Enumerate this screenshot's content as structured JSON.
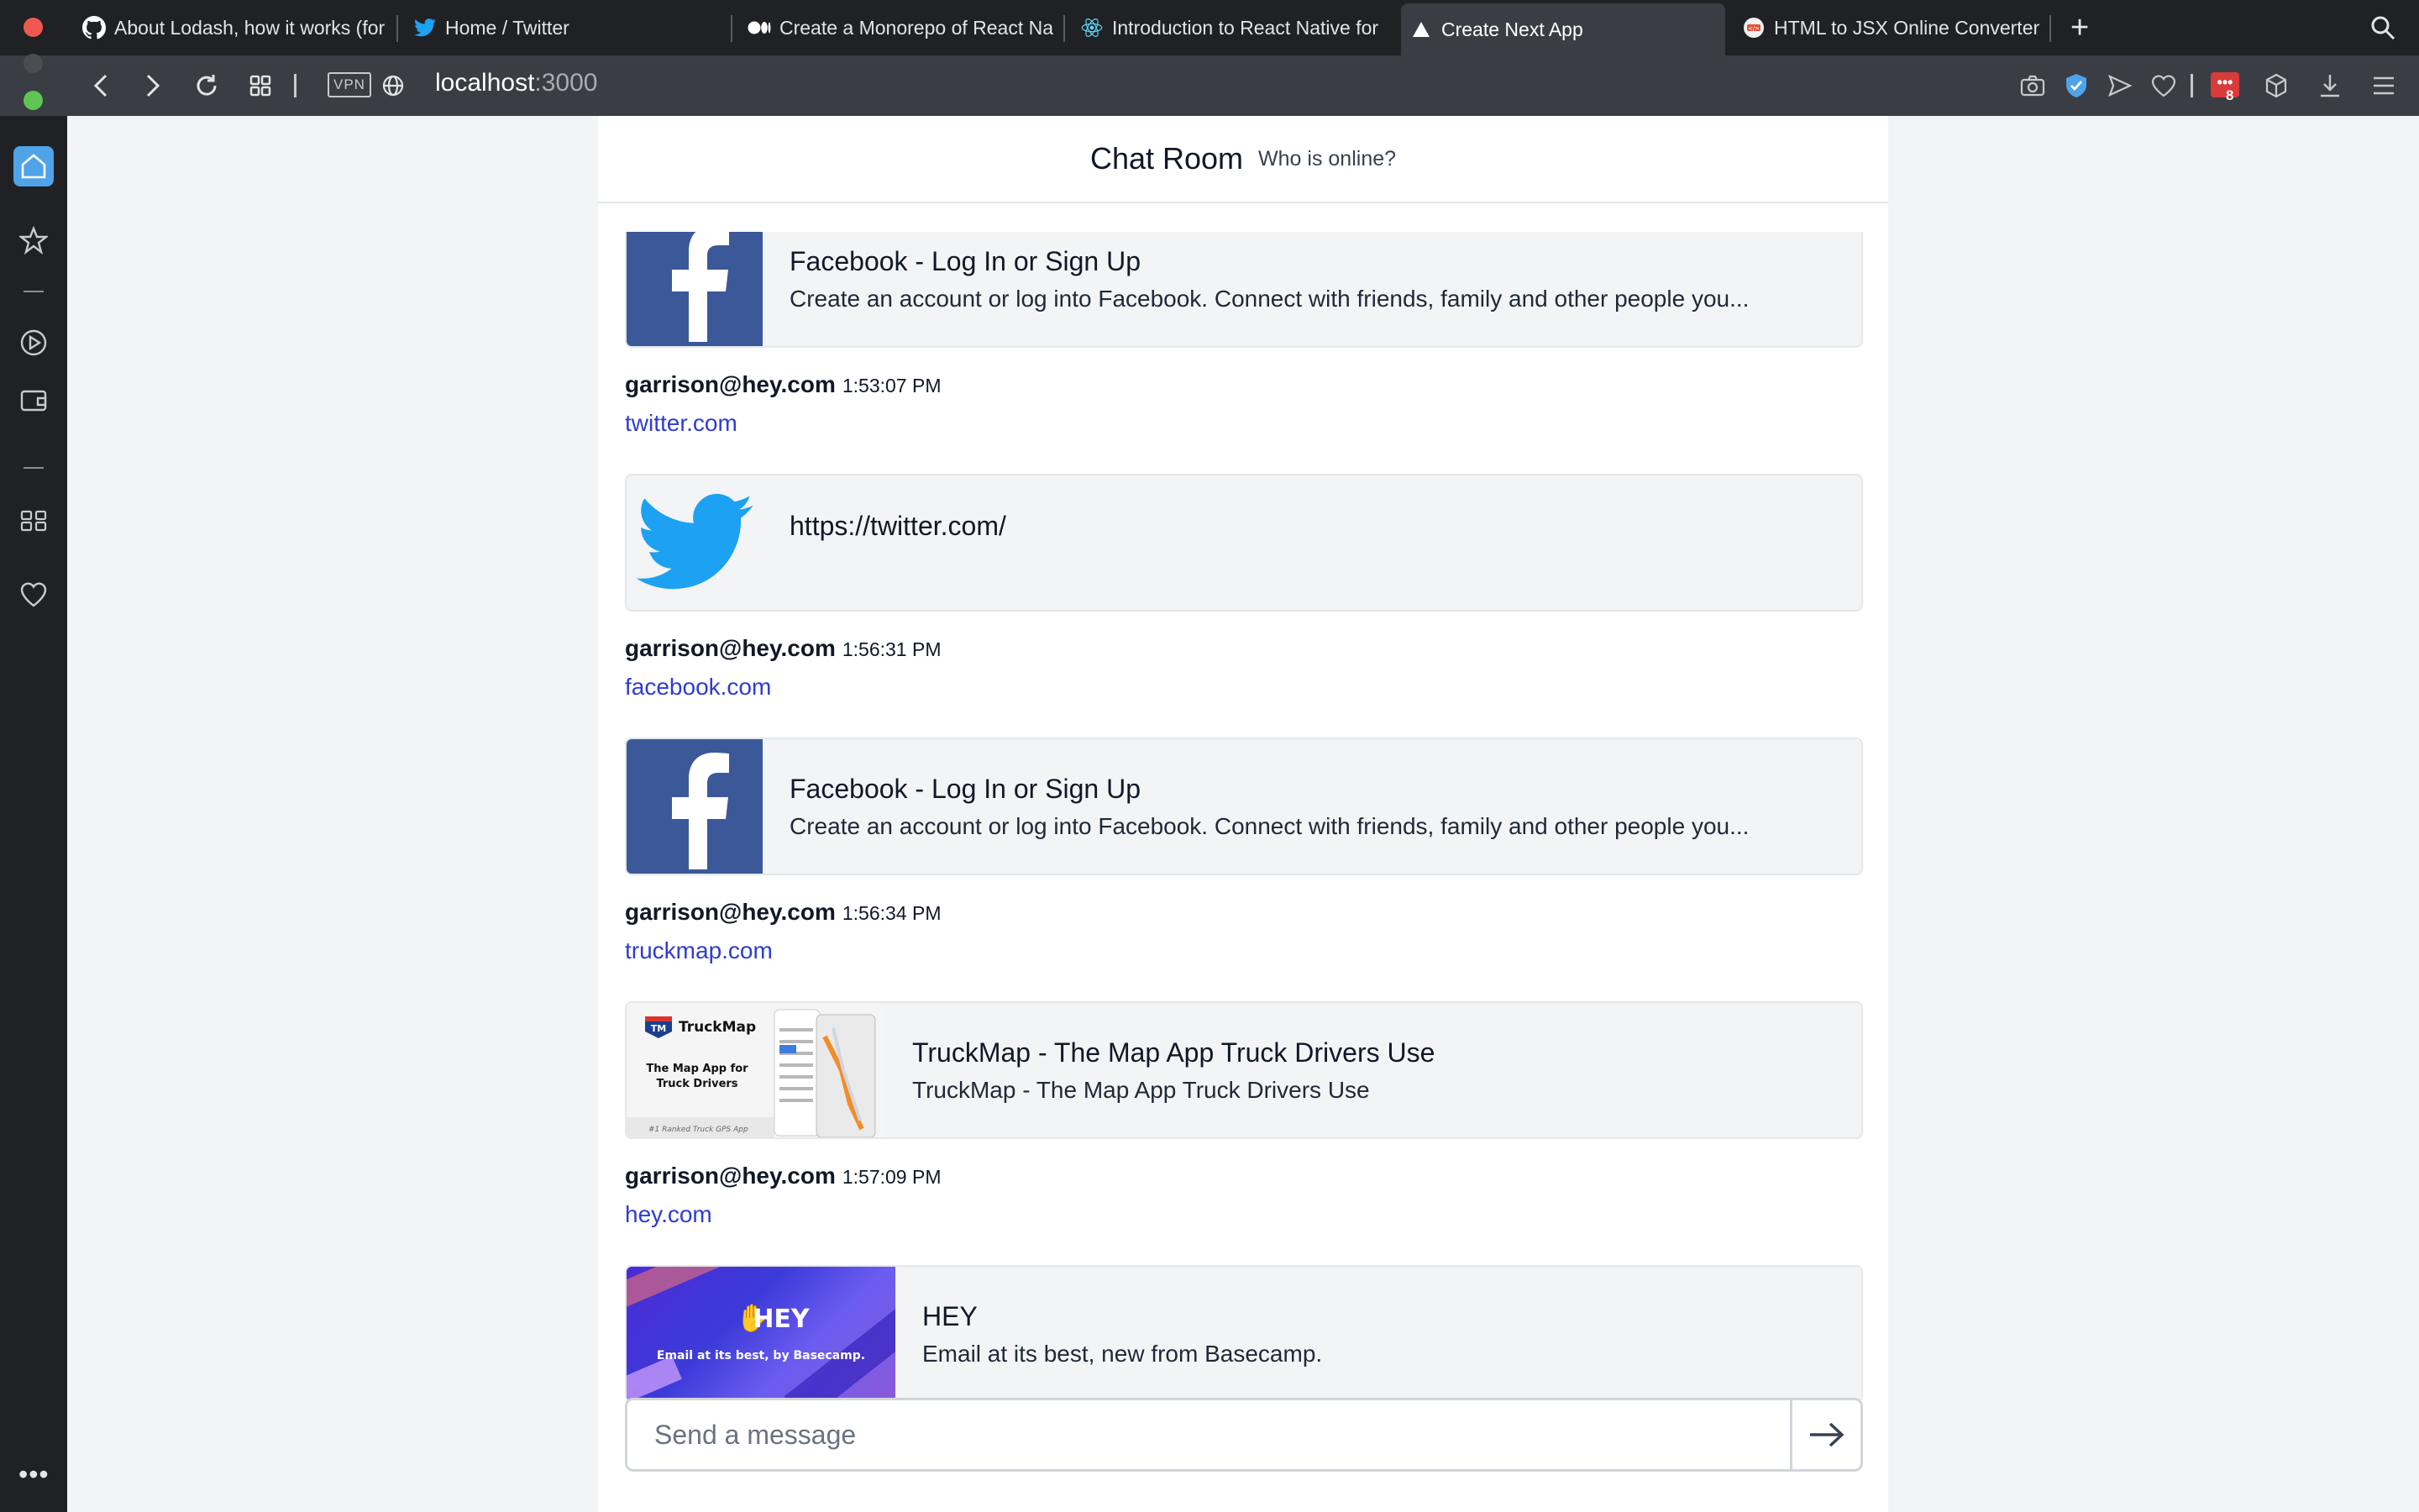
{
  "browser": {
    "tabs": [
      {
        "label": "About Lodash, how it works (for",
        "icon": "github-icon"
      },
      {
        "label": "Home / Twitter",
        "icon": "twitter-icon"
      },
      {
        "label": "Create a Monorepo of React Na",
        "icon": "medium-icon"
      },
      {
        "label": "Introduction to React Native for",
        "icon": "react-icon"
      },
      {
        "label": "Create Next App",
        "icon": "vercel-triangle-icon",
        "active": true
      },
      {
        "label": "HTML to JSX Online Converter",
        "icon": "converter-icon"
      }
    ],
    "address": {
      "vpn_label": "VPN",
      "host": "localhost",
      "port": ":3000"
    },
    "extension_badge_count": "8",
    "colors": {
      "tab_bg": "#1f2125",
      "toolbar_bg": "#3a3d43",
      "sidebar_home_accent": "#4fa3e8"
    }
  },
  "chat": {
    "title": "Chat Room",
    "online_link": "Who is online?",
    "messages": [
      {
        "preview": {
          "title": "Facebook - Log In or Sign Up",
          "description": "Create an account or log into Facebook. Connect with friends, family and other people you..."
        }
      },
      {
        "author": "garrison@hey.com",
        "time": "1:53:07 PM",
        "link": "twitter.com",
        "preview": {
          "title": "https://twitter.com/",
          "description": ""
        }
      },
      {
        "author": "garrison@hey.com",
        "time": "1:56:31 PM",
        "link": "facebook.com",
        "preview": {
          "title": "Facebook - Log In or Sign Up",
          "description": "Create an account or log into Facebook. Connect with friends, family and other people you..."
        }
      },
      {
        "author": "garrison@hey.com",
        "time": "1:56:34 PM",
        "link": "truckmap.com",
        "preview": {
          "title": "TruckMap - The Map App Truck Drivers Use",
          "description": "TruckMap - The Map App Truck Drivers Use",
          "thumb_brand": "TruckMap",
          "thumb_tagline": "The Map App for Truck Drivers",
          "thumb_footer": "#1 Ranked Truck GPS App"
        }
      },
      {
        "author": "garrison@hey.com",
        "time": "1:57:09 PM",
        "link": "hey.com",
        "preview": {
          "title": "HEY",
          "description": "Email at its best, new from Basecamp.",
          "thumb_brand": "HEY",
          "thumb_tagline": "Email at its best, by Basecamp."
        }
      }
    ],
    "composer": {
      "placeholder": "Send a message"
    },
    "colors": {
      "link": "#2f3cd1",
      "preview_bg": "#f3f4f6",
      "facebook_blue": "#3b5998",
      "twitter_blue": "#1da1f2"
    }
  }
}
